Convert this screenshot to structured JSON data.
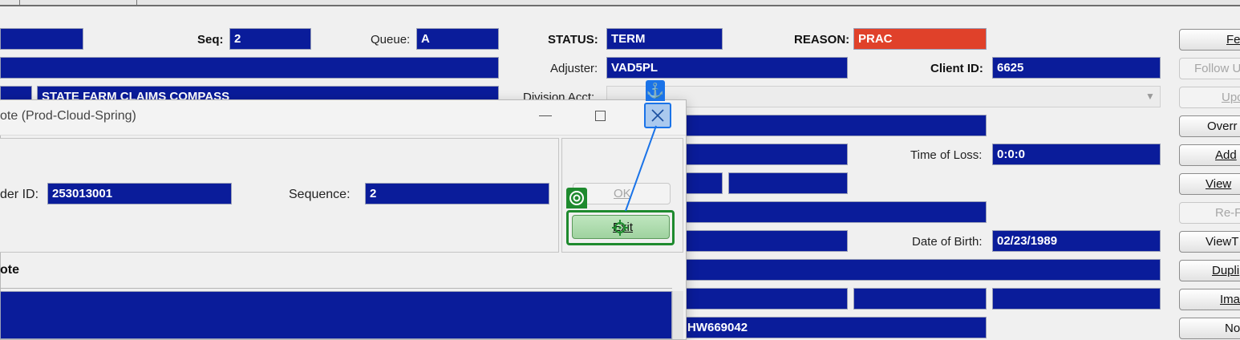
{
  "main_form": {
    "seq_label": "Seq:",
    "seq_value": "2",
    "queue_label": "Queue:",
    "queue_value": "A",
    "status_label": "STATUS:",
    "status_value": "TERM",
    "reason_label": "REASON:",
    "reason_value": "PRAC",
    "adjuster_label": "Adjuster:",
    "adjuster_value": "VAD5PL",
    "client_id_label": "Client ID:",
    "client_id_value": "6625",
    "carrier_name": "STATE FARM CLAIMS COMPASS",
    "division_acct_label": "Division Acct:",
    "time_of_loss_label": "Time of Loss:",
    "time_of_loss_value": "0:0:0",
    "dob_label": "Date of Birth:",
    "dob_value": "02/23/1989",
    "bottom_value_partial": "HW669042"
  },
  "right_buttons": [
    {
      "label": "Fe",
      "enabled": true
    },
    {
      "label": "Follow U",
      "enabled": false
    },
    {
      "label": "Upc",
      "enabled": false
    },
    {
      "label": "Overr",
      "enabled": true
    },
    {
      "label": "Add",
      "enabled": true
    },
    {
      "label": "View",
      "enabled": true
    },
    {
      "label": "Re-F",
      "enabled": false
    },
    {
      "label": "ViewT",
      "enabled": true
    },
    {
      "label": "Dupli",
      "enabled": true
    },
    {
      "label": "Ima",
      "enabled": true
    },
    {
      "label": "No",
      "enabled": true
    }
  ],
  "dialog": {
    "title": "ote (Prod-Cloud-Spring)",
    "order_id_label": "der ID:",
    "order_id_value": "253013001",
    "sequence_label": "Sequence:",
    "sequence_value": "2",
    "ok_label": "OK",
    "exit_label": "Exit",
    "note_section_label": "ote"
  },
  "colors": {
    "field_bg": "#0a1c9a",
    "reason_bg": "#e0412a",
    "annotation_blue": "#1a73e8",
    "annotation_green": "#1e8a2e"
  }
}
